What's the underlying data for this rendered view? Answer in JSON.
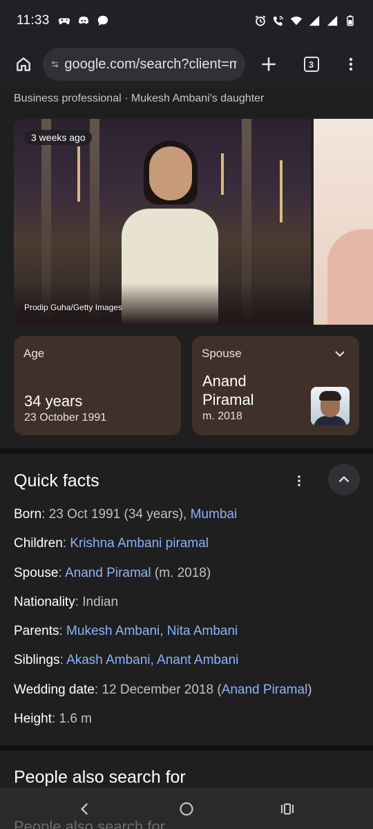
{
  "status_bar": {
    "time": "11:33",
    "left_icons": [
      "game-controller-icon",
      "discord-icon",
      "chat-bubble-icon"
    ],
    "right_icons": [
      "alarm-icon",
      "wifi-calling-icon",
      "wifi-icon",
      "signal-icon",
      "signal-icon",
      "battery-icon"
    ]
  },
  "browser": {
    "url": "google.com/search?client=ms-android-samsung",
    "tab_count": "3"
  },
  "knowledge_panel": {
    "subtitle": "Business professional · Mukesh Ambani's daughter",
    "image": {
      "badge": "3 weeks ago",
      "credit": "Prodip Guha/Getty Images"
    },
    "age_card": {
      "label": "Age",
      "value": "34 years",
      "detail": "23 October 1991"
    },
    "spouse_card": {
      "label": "Spouse",
      "name_line1": "Anand",
      "name_line2": "Piramal",
      "detail": "m. 2018"
    }
  },
  "quick_facts": {
    "title": "Quick facts",
    "born": {
      "key": "Born",
      "text": ": 23 Oct 1991 (34 years), ",
      "link": "Mumbai"
    },
    "children": {
      "key": "Children",
      "sep": ": ",
      "link": "Krishna Ambani piramal"
    },
    "spouse": {
      "key": "Spouse",
      "sep": ": ",
      "link": "Anand Piramal",
      "suffix": " (m. 2018)"
    },
    "nationality": {
      "key": "Nationality",
      "text": ": Indian"
    },
    "parents": {
      "key": "Parents",
      "sep": ": ",
      "link1": "Mukesh Ambani",
      "comma": ", ",
      "link2": "Nita Ambani"
    },
    "siblings": {
      "key": "Siblings",
      "sep": ": ",
      "link1": "Akash Ambani",
      "comma": ", ",
      "link2": "Anant Ambani"
    },
    "wedding": {
      "key": "Wedding date",
      "text": ": 12 December 2018 (",
      "link": "Anand Piramal",
      "close": ")"
    },
    "height": {
      "key": "Height",
      "text": ": 1.6 m"
    }
  },
  "people_also_search": {
    "title": "People also search for",
    "ghost_title": "People also search for"
  }
}
